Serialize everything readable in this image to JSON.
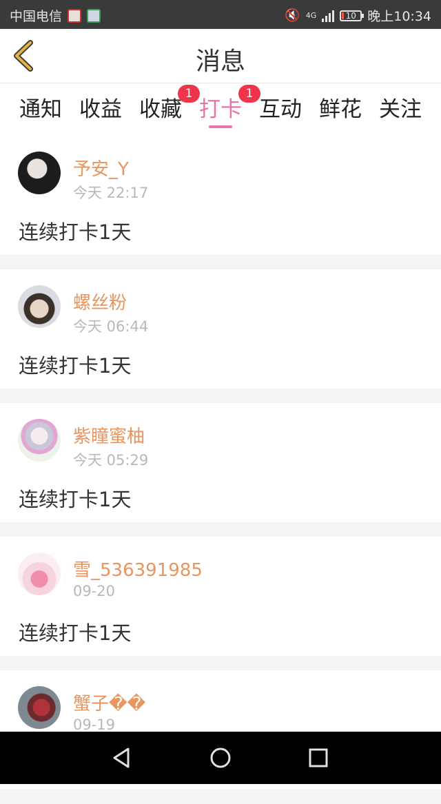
{
  "status_bar": {
    "carrier": "中国电信",
    "network": "4G",
    "battery": "10",
    "time": "晚上10:34",
    "icons": [
      "news-app-icon",
      "video-app-icon",
      "mute-icon",
      "signal-icon",
      "battery-icon"
    ]
  },
  "header": {
    "title": "消息",
    "back_icon": "chevron-left-icon"
  },
  "tabs": [
    {
      "label": "通知",
      "badge": ""
    },
    {
      "label": "收益",
      "badge": ""
    },
    {
      "label": "收藏",
      "badge": "1"
    },
    {
      "label": "打卡",
      "badge": "",
      "active": true
    },
    {
      "label": "互动",
      "badge": "1"
    },
    {
      "label": "鲜花",
      "badge": ""
    },
    {
      "label": "关注",
      "badge": ""
    }
  ],
  "messages": [
    {
      "name": "予安_Y",
      "time": "今天 22:17",
      "text": "连续打卡1天"
    },
    {
      "name": "螺丝粉",
      "time": "今天 06:44",
      "text": "连续打卡1天"
    },
    {
      "name": "紫瞳蜜柚",
      "time": "今天 05:29",
      "text": "连续打卡1天"
    },
    {
      "name": "雪_536391985",
      "time": "09-20",
      "text": "连续打卡1天"
    },
    {
      "name": "蟹子��",
      "time": "09-19",
      "text": ""
    }
  ],
  "colors": {
    "accent": "#e873a8",
    "username": "#e8955f",
    "badge": "#f0344c",
    "back_arrow": "#e3b540"
  },
  "nav_bar": {
    "icons": [
      "back-triangle-icon",
      "home-circle-icon",
      "recents-square-icon"
    ]
  }
}
